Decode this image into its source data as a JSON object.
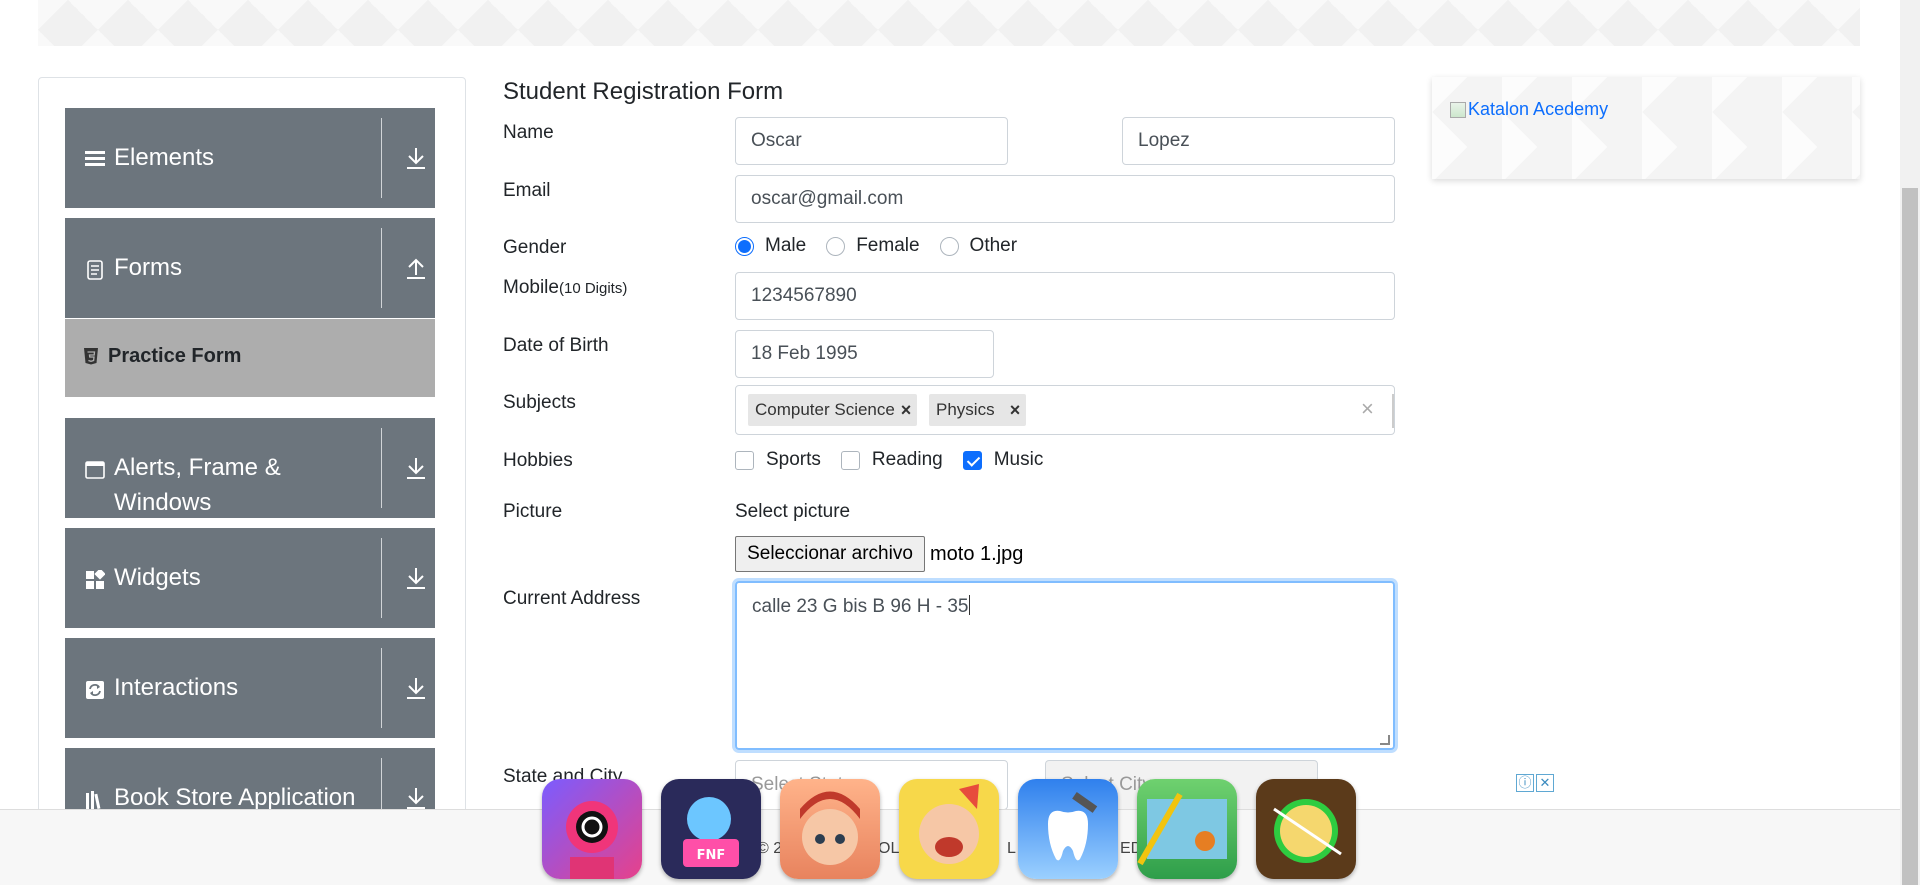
{
  "sidebar": {
    "groups": [
      {
        "label": "Elements",
        "icon": "hamburger-icon",
        "arrow": "download-arrow-icon"
      },
      {
        "label": "Forms",
        "icon": "document-icon",
        "arrow": "upload-arrow-icon"
      },
      {
        "label": "Alerts, Frame &",
        "label2": "Windows",
        "icon": "window-icon",
        "arrow": "download-arrow-icon"
      },
      {
        "label": "Widgets",
        "icon": "widgets-icon",
        "arrow": "download-arrow-icon"
      },
      {
        "label": "Interactions",
        "icon": "refresh-icon",
        "arrow": "download-arrow-icon"
      },
      {
        "label": "Book Store Application",
        "icon": "books-icon",
        "arrow": "download-arrow-icon"
      }
    ],
    "active_item": {
      "label": "Practice Form",
      "icon": "html5-icon"
    }
  },
  "form": {
    "title": "Student Registration Form",
    "labels": {
      "name": "Name",
      "email": "Email",
      "gender": "Gender",
      "mobile": "Mobile",
      "mobile_hint": "(10 Digits)",
      "dob": "Date of Birth",
      "subjects": "Subjects",
      "hobbies": "Hobbies",
      "picture": "Picture",
      "address": "Current Address",
      "state_city": "State and City"
    },
    "first_name": "Oscar",
    "last_name": "Lopez",
    "email": "oscar@gmail.com",
    "gender_options": [
      {
        "label": "Male",
        "selected": true
      },
      {
        "label": "Female",
        "selected": false
      },
      {
        "label": "Other",
        "selected": false
      }
    ],
    "mobile": "1234567890",
    "dob": "18 Feb 1995",
    "subjects": [
      "Computer Science",
      "Physics"
    ],
    "subjects_remove": "×",
    "subjects_clear": "×",
    "hobbies": [
      {
        "label": "Sports",
        "checked": false
      },
      {
        "label": "Reading",
        "checked": false
      },
      {
        "label": "Music",
        "checked": true
      }
    ],
    "picture_label": "Select picture",
    "file_button": "Seleccionar archivo",
    "file_name": "moto 1.jpg",
    "address": "calle 23 G bis B 96 H - 35",
    "state_placeholder": "Select State",
    "city_placeholder": "Select City"
  },
  "ad": {
    "link_text": "Katalon Acedemy"
  },
  "footer": {
    "left": "© 2",
    "mid1": "OLS",
    "mid2": "L R",
    "right": "ED"
  },
  "ad_strip": {
    "info_icon": "ⓘ",
    "close_icon": "✕",
    "tiles": [
      "squid-game-app-icon",
      "friday-night-funkin-app-icon",
      "hair-salon-app-icon",
      "fruit-eater-app-icon",
      "dentist-app-icon",
      "rescue-pin-app-icon",
      "fruit-ninja-app-icon"
    ]
  },
  "colors": {
    "sidebar": "#6c757d",
    "active": "#adadad",
    "accent": "#0d6efd"
  }
}
